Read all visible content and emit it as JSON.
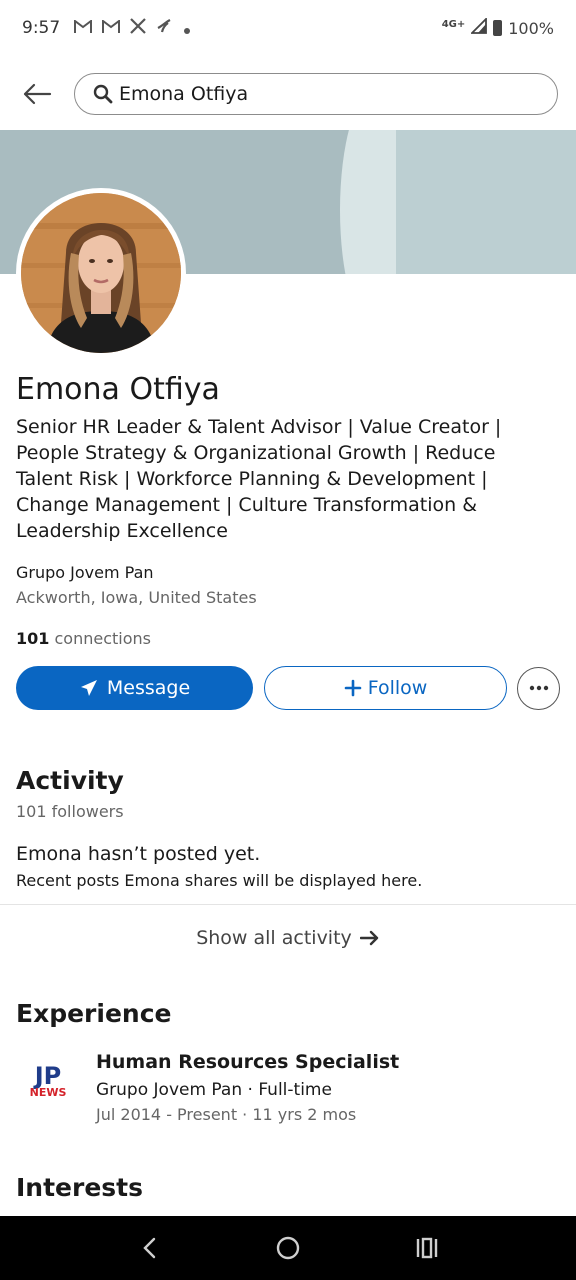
{
  "status_bar": {
    "time": "9:57",
    "network": "4G+",
    "battery": "100%"
  },
  "search": {
    "query": "Emona Otfiya"
  },
  "profile": {
    "name": "Emona Otfiya",
    "headline": "Senior HR Leader & Talent Advisor | Value Creator | People Strategy & Organizational Growth | Reduce Talent Risk | Workforce Planning & Development | Change Management | Culture Transformation & Leadership Excellence",
    "company": "Grupo Jovem Pan",
    "location": "Ackworth, Iowa, United States",
    "connections_count": "101",
    "connections_label": "connections"
  },
  "actions": {
    "message_label": "Message",
    "follow_label": "Follow"
  },
  "activity": {
    "title": "Activity",
    "followers": "101 followers",
    "empty_title": "Emona hasn’t posted yet.",
    "empty_sub": "Recent posts Emona shares will be displayed here.",
    "show_all": "Show all activity"
  },
  "experience": {
    "title": "Experience",
    "logo_text_top": "JP",
    "logo_text_bottom": "NEWS",
    "role": "Human Resources Specialist",
    "company_line": "Grupo Jovem Pan · Full-time",
    "dates": "Jul 2014 - Present · 11 yrs 2 mos"
  },
  "interests": {
    "title": "Interests"
  },
  "colors": {
    "primary": "#0a66c2",
    "banner": "#a9bcc0",
    "logo_blue": "#1f3c8a",
    "logo_red": "#d4222a"
  }
}
